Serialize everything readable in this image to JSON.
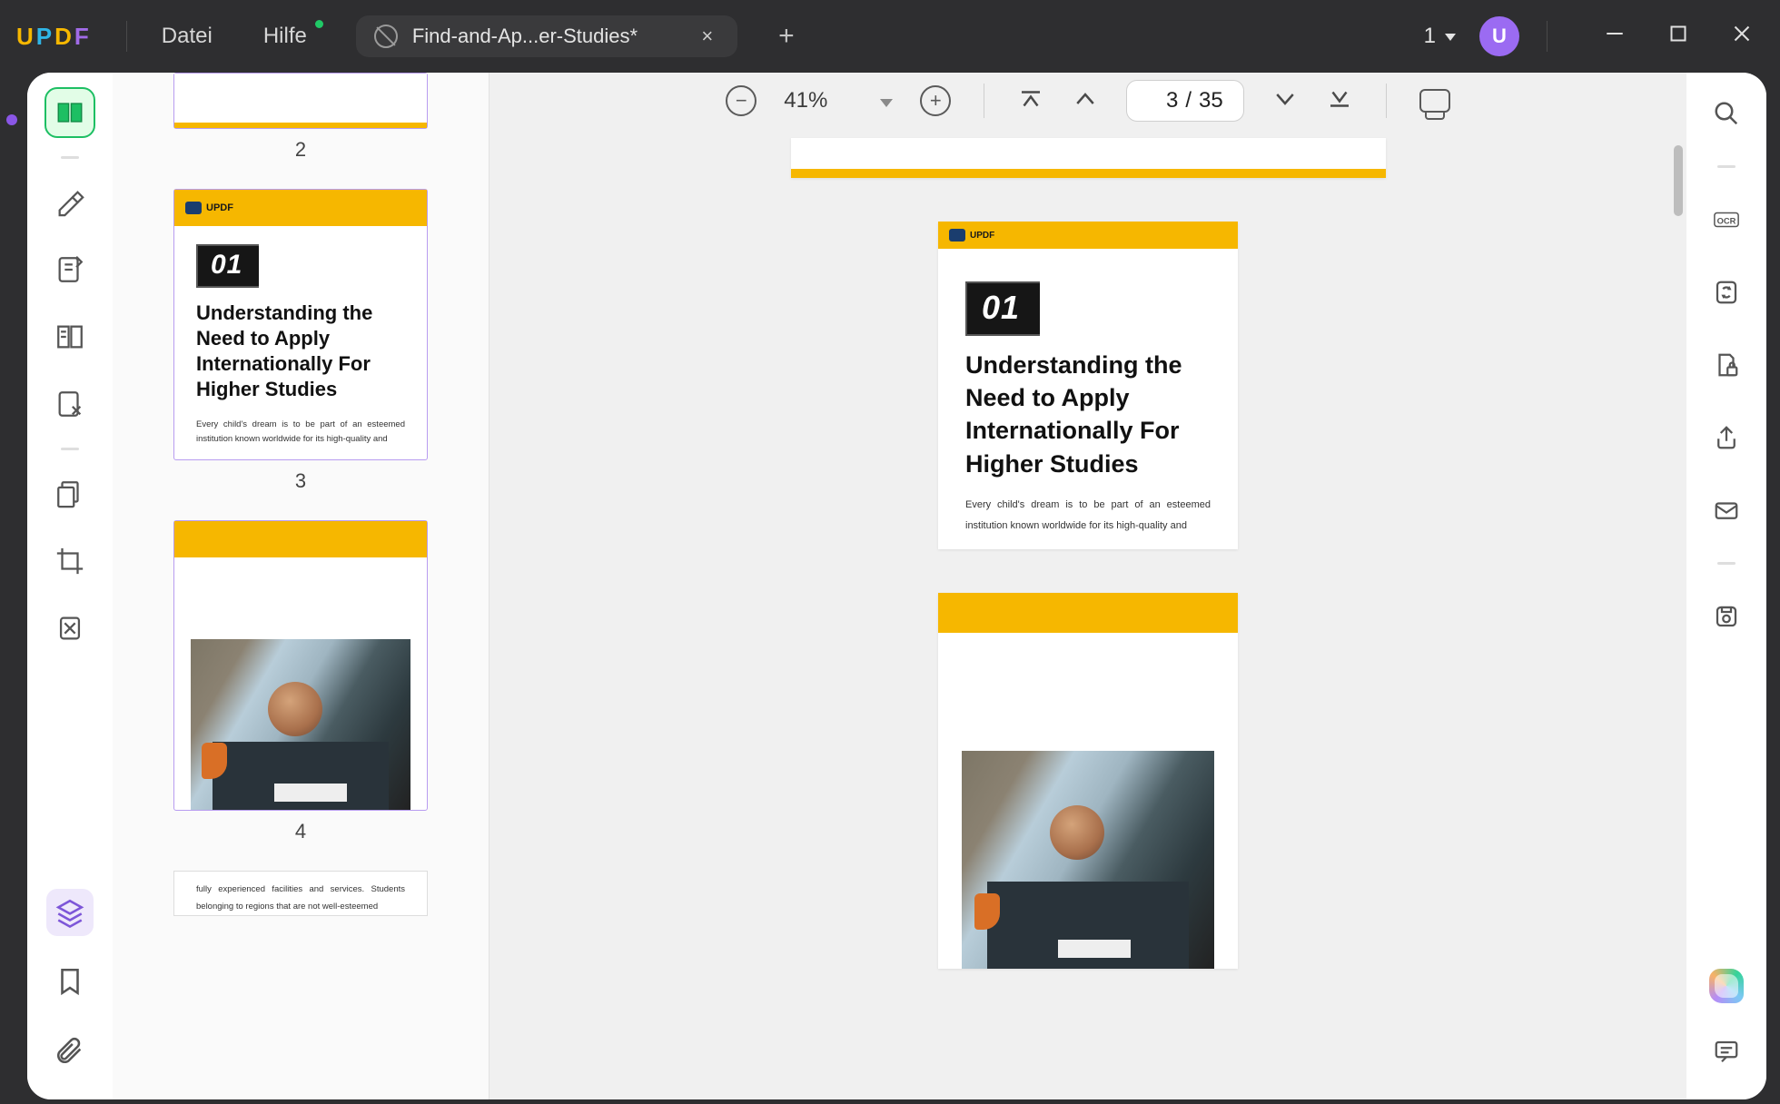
{
  "menu": {
    "file": "Datei",
    "help": "Hilfe"
  },
  "tab": {
    "title": "Find-and-Ap...er-Studies*",
    "close": "×",
    "add": "+"
  },
  "windowCounter": "1",
  "avatar": "U",
  "toolbar": {
    "zoomMinus": "−",
    "zoomPlus": "+",
    "zoomValue": "41%",
    "pageCurrent": "3",
    "pageSep": "/",
    "pageTotal": "35"
  },
  "doc": {
    "brand": "UPDF",
    "badge": "01",
    "heading": "Understanding the Need to Apply Internationally For Higher Studies",
    "para": "Every child's dream is to be part of an esteemed institution known worldwide for its high-quality and"
  },
  "thumbLabels": {
    "p2": "2",
    "p3": "3",
    "p4": "4"
  },
  "page5": {
    "para": "fully experienced facilities and services. Students belonging to regions that are not well-esteemed"
  },
  "rightRail": {
    "ocrLabel": "OCR"
  }
}
